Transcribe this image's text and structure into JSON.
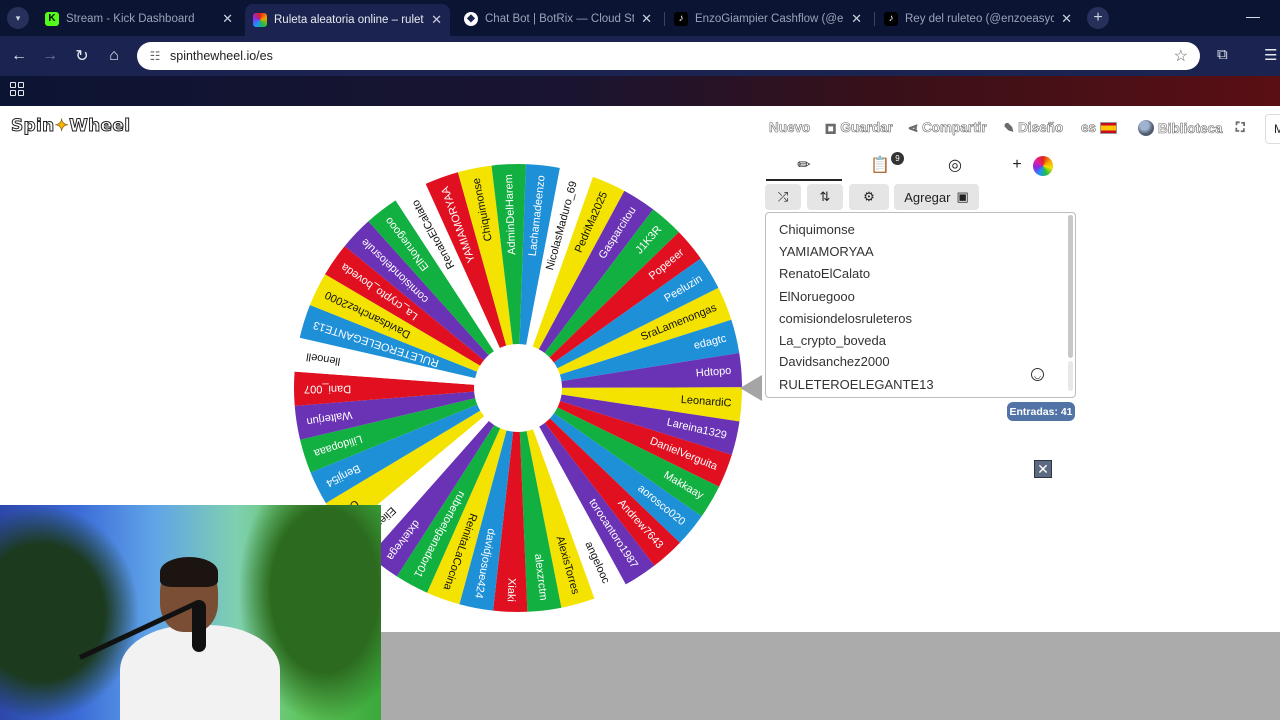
{
  "browser": {
    "tabs": [
      {
        "title": "Stream - Kick Dashboard",
        "favicon": "kick-icon",
        "active": false
      },
      {
        "title": "Ruleta aleatoria online – ruleta",
        "favicon": "spinthewheel-icon",
        "active": true
      },
      {
        "title": "Chat Bot | BotRix — Cloud Stre",
        "favicon": "botrix-icon",
        "active": false
      },
      {
        "title": "EnzoGiampier Cashflow (@enz",
        "favicon": "tiktok-icon",
        "active": false
      },
      {
        "title": "Rey del ruleteo (@enzoeasycas",
        "favicon": "tiktok-icon",
        "active": false
      }
    ],
    "url": "spinthewheel.io/es"
  },
  "site": {
    "logo_part1": "Spin",
    "logo_part2": "Wheel",
    "menu": {
      "new": "Nuevo",
      "save": "Guardar",
      "share": "Compartir",
      "design": "Diseño",
      "lang": "es",
      "library": "Biblioteca",
      "side": "M"
    }
  },
  "panel": {
    "results_badge": "9",
    "add_label": "Agregar",
    "entries": [
      "Chiquimonse",
      "YAMIAMORYAA",
      "RenatoElCalato",
      "ElNoruegooo",
      "comisiondelosruleteros",
      "La_crypto_boveda",
      "Davidsanchez2000",
      "RULETEROELEGANTE13"
    ],
    "count_label": "Entradas: 41"
  },
  "wheel": {
    "colors": [
      "#1e90d8",
      "#f4e300",
      "#6a32b4",
      "#12b040",
      "#e01020",
      "#ffffff"
    ],
    "seq": [
      0,
      5,
      1,
      2,
      3,
      4,
      0,
      1,
      0,
      2,
      1,
      2,
      4,
      3,
      0,
      4,
      2,
      5,
      1,
      3,
      4,
      0,
      1,
      3,
      2,
      5,
      1,
      0,
      3,
      2,
      4,
      5,
      0,
      1,
      4,
      2,
      3,
      5,
      4,
      1,
      3
    ],
    "names": [
      "Lachamadeenzo",
      "NicolasMaduro_69",
      "PedriMa2025",
      "Gasparcitou",
      "J1K3R",
      "Popeeer",
      "Peeluzin",
      "SraLamenongas",
      "edagtc",
      "Hdtopo",
      "LeonardiC",
      "Lareina1329",
      "DanielVerguita",
      "Makkaay",
      "aorosco020",
      "Andrew7643",
      "torocantoro1987",
      "angelooc",
      "AlexisTorres",
      "alexzrctm",
      "Xiaki",
      "davidjosue424",
      "ReinitaLaCocina",
      "rubertoelganador01",
      "dxtelvega",
      "ElienaiU",
      "C...",
      "Benji54",
      "Lilidopaaa",
      "Walterjun",
      "Dani_007",
      "llenoell",
      "RULETEROELEGANTE13",
      "Davidsanchez2000",
      "La_crypto_boveda",
      "comisiondelosrule",
      "ElNoruegooo",
      "RenatoElCalato",
      "YAMIAMORYAA",
      "Chiquimonse",
      "AdminDelHarem"
    ],
    "start_angle_deg": -88
  }
}
